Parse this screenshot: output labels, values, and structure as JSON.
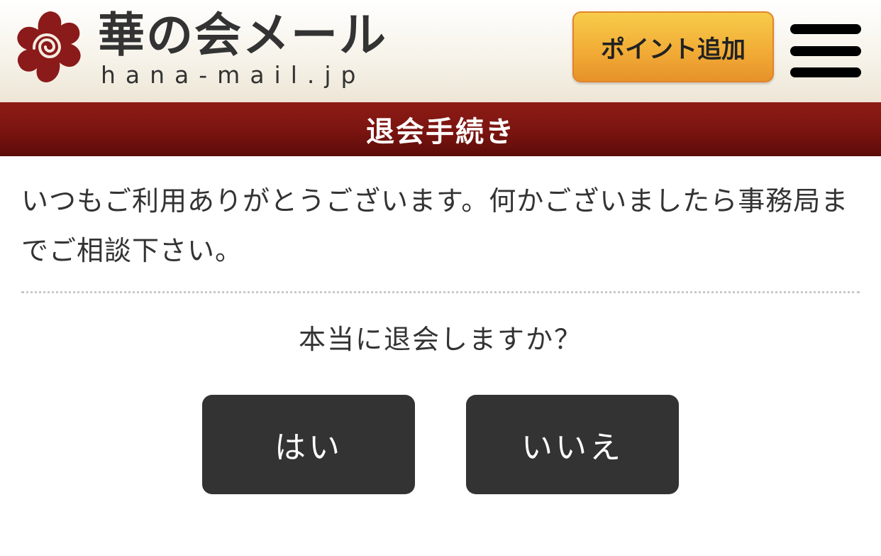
{
  "header": {
    "logo_title": "華の会メール",
    "logo_domain": "hana-mail.jp",
    "point_button_label": "ポイント追加",
    "menu_icon": "hamburger-menu-icon"
  },
  "page_title": "退会手続き",
  "message": "いつもご利用ありがとうございます。何かございましたら事務局までご相談下さい。",
  "question": "本当に退会しますか？",
  "buttons": {
    "yes_label": "はい",
    "no_label": "いいえ"
  },
  "colors": {
    "title_bar": "#7a1410",
    "point_button": "#f1aa35",
    "action_button": "#333333",
    "logo_flower": "#8b1a1a"
  }
}
